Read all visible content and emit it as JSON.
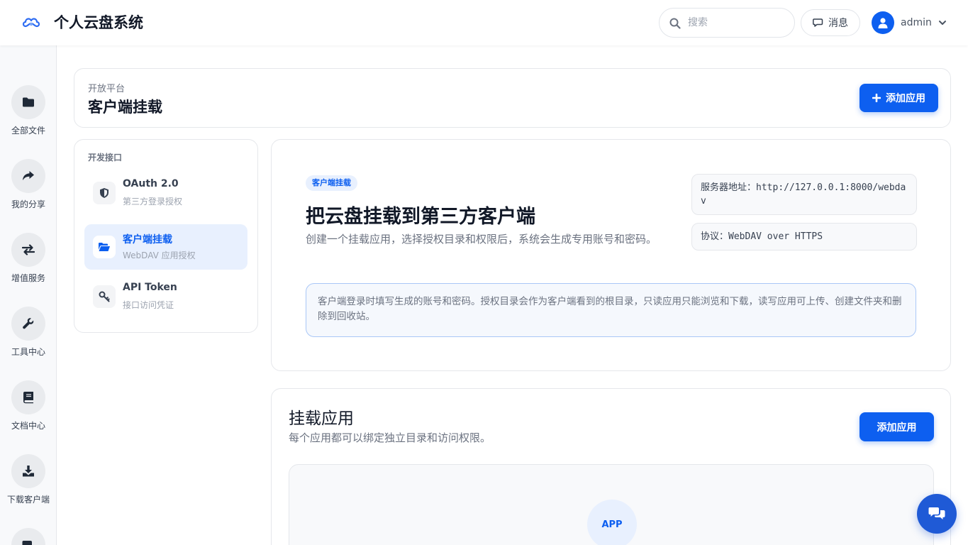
{
  "app": {
    "name": "个人云盘系统"
  },
  "topbar": {
    "search_placeholder": "搜索",
    "messages_label": "消息",
    "user_name": "admin"
  },
  "sidebar": {
    "items": [
      {
        "label": "全部文件",
        "icon": "folder-icon"
      },
      {
        "label": "我的分享",
        "icon": "share-icon"
      },
      {
        "label": "增值服务",
        "icon": "exchange-icon"
      },
      {
        "label": "工具中心",
        "icon": "wrench-icon"
      },
      {
        "label": "文档中心",
        "icon": "book-icon"
      },
      {
        "label": "下载客户端",
        "icon": "download-icon"
      }
    ]
  },
  "header": {
    "breadcrumb": "开放平台",
    "title": "客户端挂载",
    "add_button": "添加应用"
  },
  "api_nav": {
    "heading": "开发接口",
    "items": [
      {
        "title": "OAuth 2.0",
        "subtitle": "第三方登录授权",
        "icon": "shield-icon",
        "active": false
      },
      {
        "title": "客户端挂载",
        "subtitle": "WebDAV 应用授权",
        "icon": "folder-open-icon",
        "active": true
      },
      {
        "title": "API Token",
        "subtitle": "接口访问凭证",
        "icon": "key-icon",
        "active": false
      }
    ]
  },
  "intro": {
    "badge": "客户端挂载",
    "title": "把云盘挂载到第三方客户端",
    "description": "创建一个挂载应用，选择授权目录和权限后，系统会生成专用账号和密码。",
    "server_label": "服务器地址：",
    "server_value": "http://127.0.0.1:8000/webdav",
    "protocol_label": "协议：",
    "protocol_value": "WebDAV over HTTPS",
    "notice": "客户端登录时填写生成的账号和密码。授权目录会作为客户端看到的根目录，只读应用只能浏览和下载，读写应用可上传、创建文件夹和删除到回收站。"
  },
  "apps": {
    "title": "挂载应用",
    "description": "每个应用都可以绑定独立目录和访问权限。",
    "add_button": "添加应用",
    "empty_icon_label": "APP"
  },
  "colors": {
    "primary": "#0d5ff0",
    "chat_fab": "#1f5ad6"
  }
}
